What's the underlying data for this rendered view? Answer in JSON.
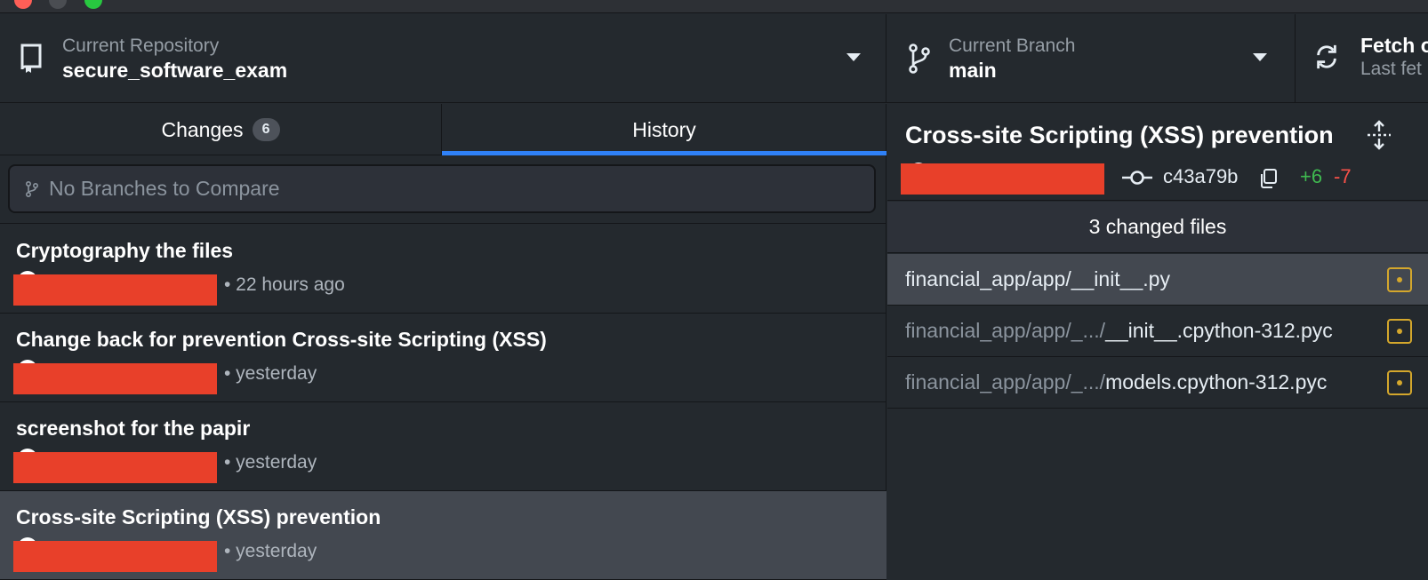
{
  "toolbar": {
    "repository": {
      "label": "Current Repository",
      "value": "secure_software_exam"
    },
    "branch": {
      "label": "Current Branch",
      "value": "main"
    },
    "fetch": {
      "label": "Fetch o",
      "sublabel": "Last fet"
    }
  },
  "tabs": {
    "changes_label": "Changes",
    "changes_count": "6",
    "history_label": "History"
  },
  "compare": {
    "placeholder": "No Branches to Compare"
  },
  "commits": [
    {
      "title": "Cryptography the files",
      "time": "• 22 hours ago"
    },
    {
      "title": "Change back for prevention Cross-site Scripting (XSS)",
      "time": "• yesterday"
    },
    {
      "title": "screenshot for the papir",
      "time": "• yesterday"
    },
    {
      "title": "Cross-site Scripting (XSS) prevention",
      "time": "• yesterday"
    }
  ],
  "detail": {
    "title": "Cross-site Scripting (XSS) prevention",
    "sha": "c43a79b",
    "additions": "+6",
    "deletions": "-7",
    "changed_files_label": "3 changed files",
    "files": [
      {
        "dim": "",
        "bright": "financial_app/app/__init__.py"
      },
      {
        "dim": "financial_app/app/_.../",
        "bright": "__init__.cpython-312.pyc"
      },
      {
        "dim": "financial_app/app/_.../",
        "bright": "models.cpython-312.pyc"
      }
    ]
  },
  "colors": {
    "accent_tab": "#2f81f7",
    "added": "#3fb950",
    "deleted": "#f85149",
    "modified": "#d4a72c",
    "redaction": "#e8402a"
  }
}
